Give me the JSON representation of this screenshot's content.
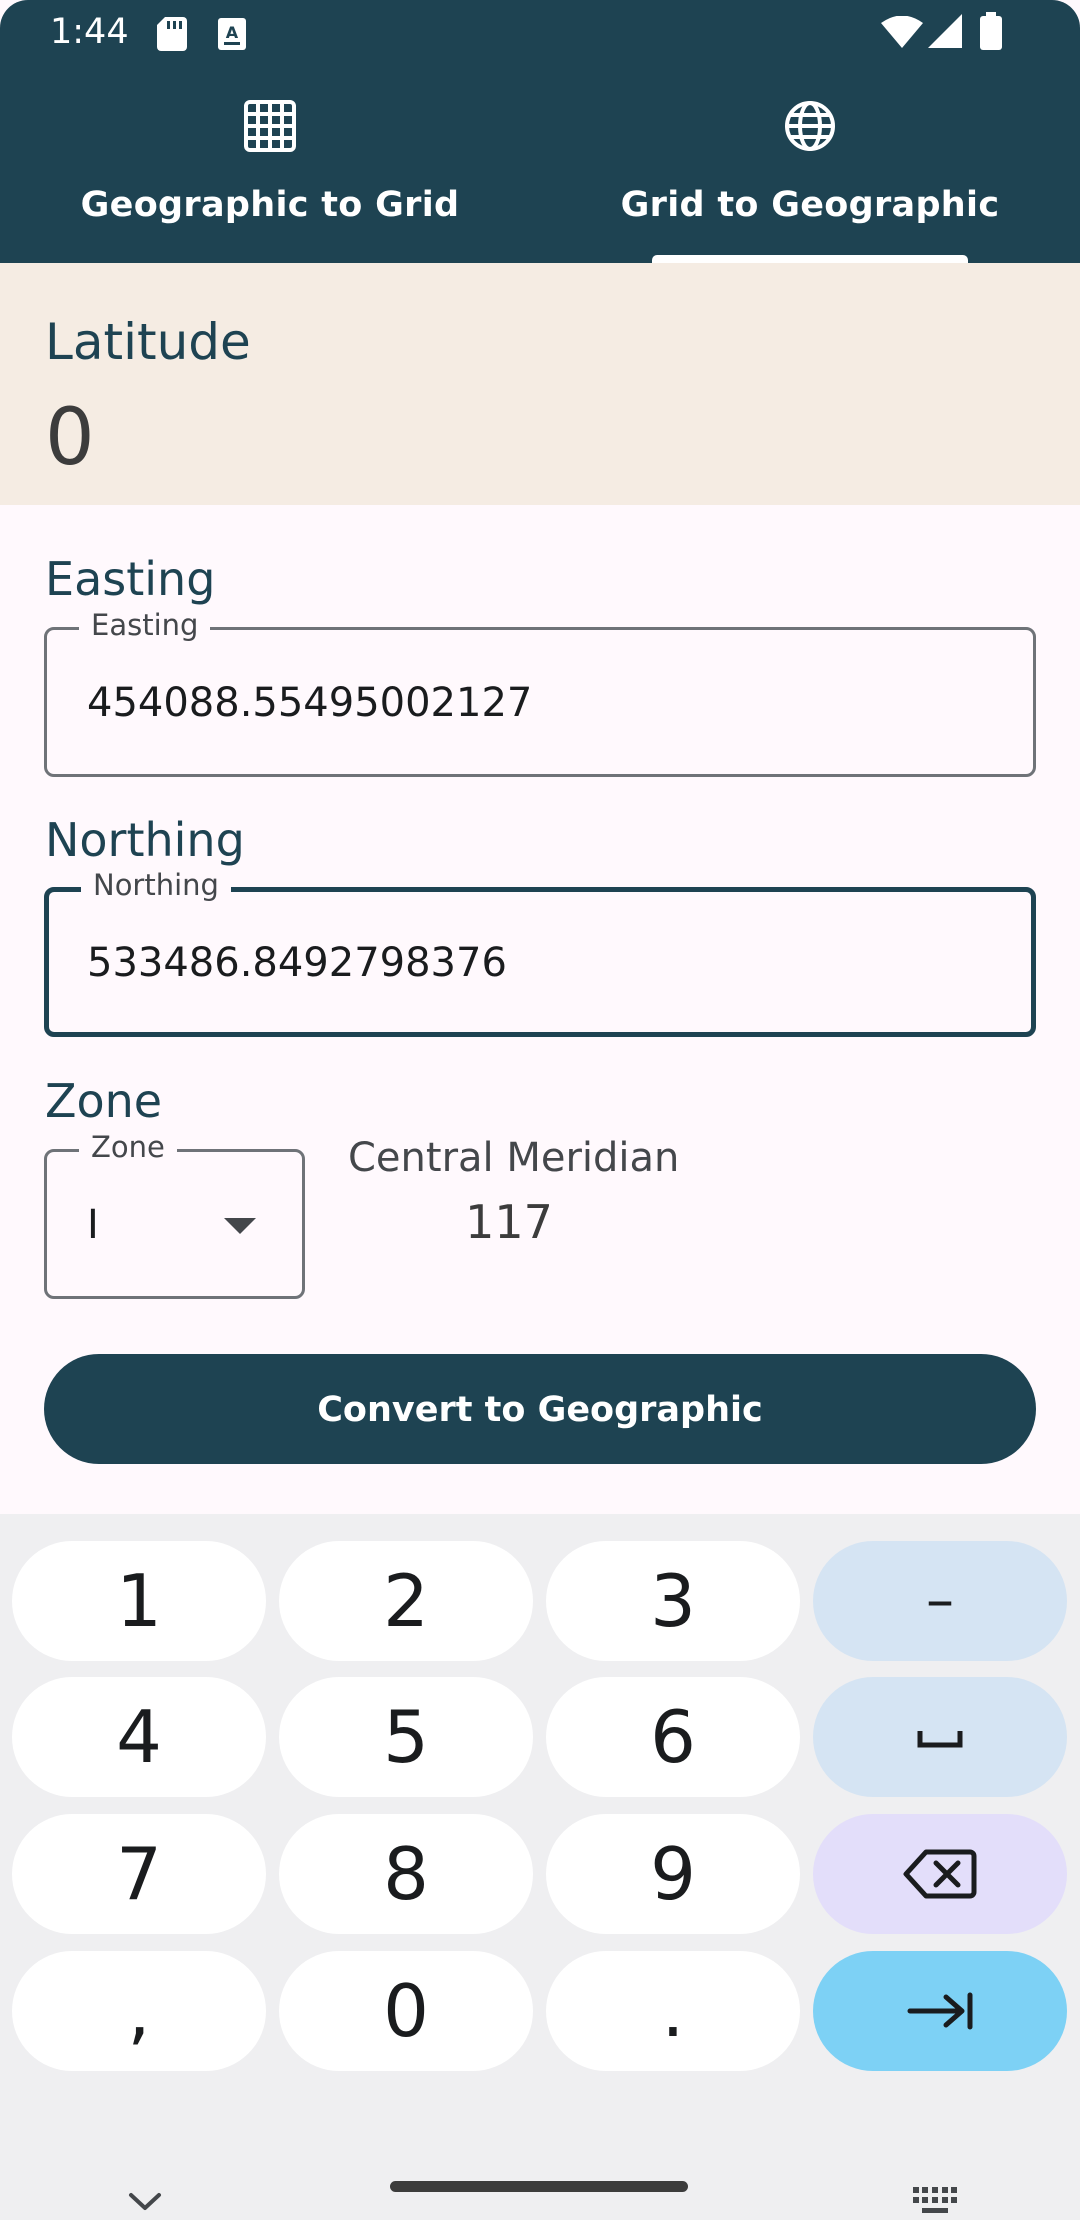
{
  "status_bar": {
    "time": "1:44",
    "icons": [
      "sd-card-icon",
      "text-notification-icon",
      "wifi-icon",
      "signal-icon",
      "battery-icon"
    ]
  },
  "tabs": [
    {
      "label": "Geographic to Grid",
      "icon": "grid-icon",
      "selected": false
    },
    {
      "label": "Grid to Geographic",
      "icon": "globe-icon",
      "selected": true
    }
  ],
  "result": {
    "label": "Latitude",
    "value": "0"
  },
  "form": {
    "easting": {
      "title": "Easting",
      "legend": "Easting",
      "value": "454088.55495002127"
    },
    "northing": {
      "title": "Northing",
      "legend": "Northing",
      "value": "533486.8492798376"
    },
    "zone": {
      "title": "Zone",
      "legend": "Zone",
      "value": "I"
    },
    "central_meridian": {
      "label": "Central Meridian",
      "value": "117"
    },
    "convert_label": "Convert to Geographic"
  },
  "keyboard": {
    "rows": [
      [
        "1",
        "2",
        "3",
        "–"
      ],
      [
        "4",
        "5",
        "6",
        "space"
      ],
      [
        "7",
        "8",
        "9",
        "backspace"
      ],
      [
        ",",
        "0",
        ".",
        "tab"
      ]
    ],
    "colors": {
      "key": "#FFFFFF",
      "alt": "#D5E4F3",
      "delete": "#E3DEFA",
      "action": "#7DD1F5"
    }
  },
  "colors": {
    "primary": "#1E4352",
    "result_bg": "#F5ECE3",
    "surface": "#FFF9FD"
  }
}
